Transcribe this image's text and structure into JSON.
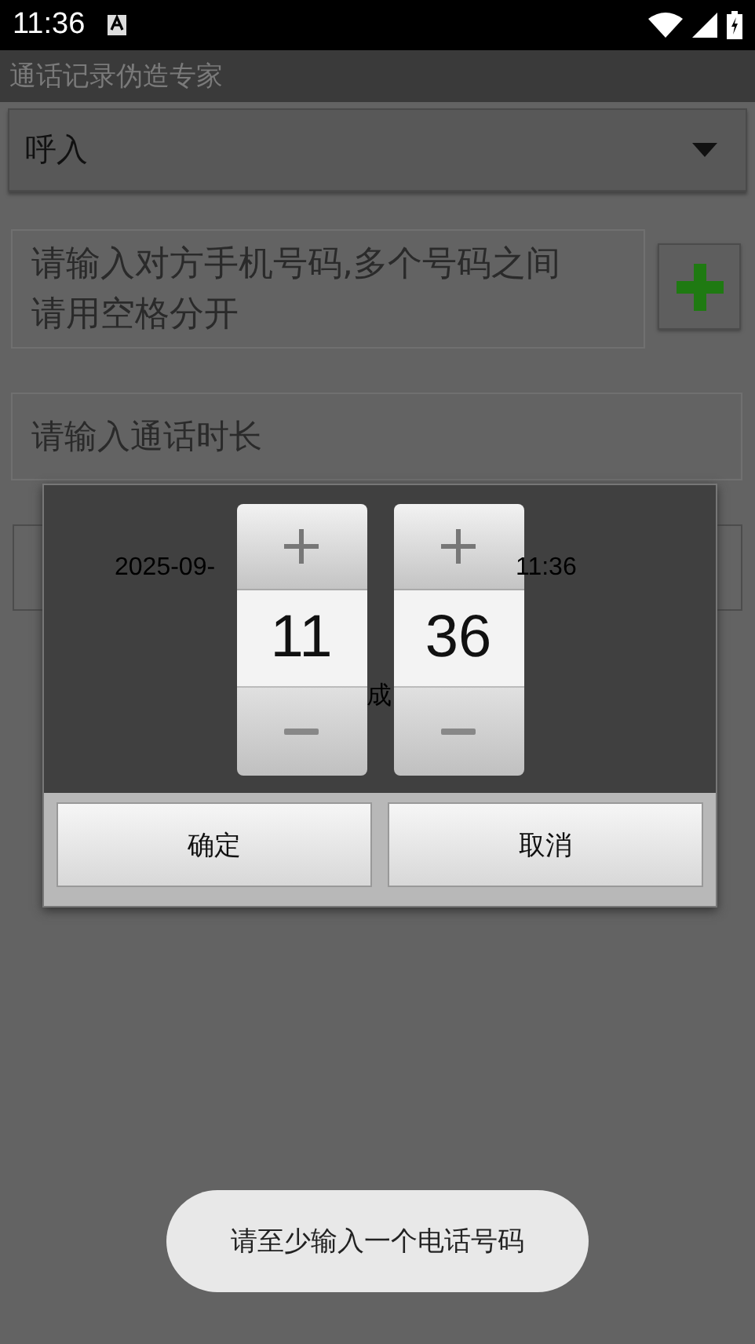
{
  "status_bar": {
    "time": "11:36"
  },
  "app_bar": {
    "title": "通话记录伪造专家"
  },
  "call_type": {
    "value": "呼入"
  },
  "phone_field": {
    "placeholder": "请输入对方手机号码,多个号码之间请用空格分开"
  },
  "duration_field": {
    "placeholder": "请输入通话时长"
  },
  "date_button": {
    "label": "2025-09-"
  },
  "time_button": {
    "label": "11:36"
  },
  "generate_button": {
    "label": "成"
  },
  "time_picker": {
    "columns": [
      {
        "value": "11"
      },
      {
        "value": "36"
      }
    ],
    "buttons": [
      "确定",
      "取消"
    ]
  },
  "toast": "请至少输入一个电话号码"
}
